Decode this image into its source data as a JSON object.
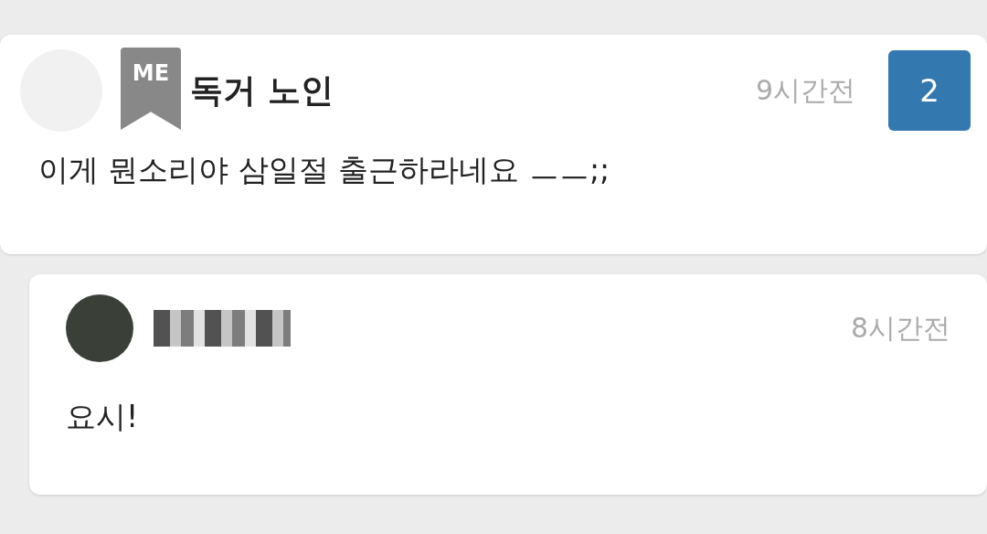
{
  "post": {
    "badge": "ME",
    "author": "독거 노인",
    "time": "9시간전",
    "comment_count": "2",
    "text": "이게 뭔소리야 삼일절 출근하라네요 ㅡㅡ;;"
  },
  "replies": [
    {
      "author_redacted": true,
      "time": "8시간전",
      "text": "요시!"
    }
  ]
}
